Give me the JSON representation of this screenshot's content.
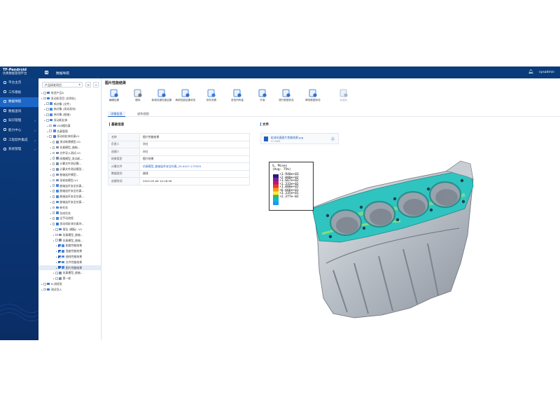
{
  "app": {
    "brand_title": "TF-Pandroid",
    "brand_subtitle": "仿真数据管理平台",
    "module_title": "数据导航",
    "user_name": "sysadmin"
  },
  "nav": {
    "items": [
      {
        "label": "平台主页",
        "active": false
      },
      {
        "label": "工作看板",
        "active": false
      },
      {
        "label": "数据导航",
        "active": true
      },
      {
        "label": "数据查询",
        "active": false
      },
      {
        "label": "知识管理",
        "active": false
      },
      {
        "label": "能力中心",
        "active": false
      },
      {
        "label": "工程软件集成",
        "active": false
      },
      {
        "label": "系统管理",
        "active": false
      }
    ]
  },
  "tree": {
    "select_value": "产品研发项目",
    "nodes": [
      {
        "label": "电池产品A",
        "indent": 1,
        "icon": "folder",
        "checked": false
      },
      {
        "label": "发动机项目 (实例化)",
        "indent": 1,
        "icon": "folder",
        "checked": false
      },
      {
        "label": "新对象 (文件)",
        "indent": 2,
        "icon": "file",
        "checked": false
      },
      {
        "label": "新对象 (发动机块)",
        "indent": 2,
        "icon": "file",
        "checked": false
      },
      {
        "label": "新对象 (曲轴)",
        "indent": 2,
        "icon": "file",
        "checked": false
      },
      {
        "label": "发动机缸体",
        "indent": 2,
        "icon": "folder",
        "checked": false
      },
      {
        "label": "V2B帽仿真",
        "indent": 3,
        "icon": "file",
        "checked": false
      },
      {
        "label": "仿真管理",
        "indent": 3,
        "icon": "file",
        "checked": false
      },
      {
        "label": "发动机缸体仿真V1",
        "indent": 3,
        "icon": "folder",
        "checked": false
      },
      {
        "label": "测试新建模型-V1",
        "indent": 4,
        "icon": "model",
        "checked": false
      },
      {
        "label": "仿真模型_曲轴…",
        "indent": 4,
        "icon": "model",
        "checked": false
      },
      {
        "label": "文件导入测试-V1",
        "indent": 4,
        "icon": "model",
        "checked": false
      },
      {
        "label": "网格模型_发动机…",
        "indent": 4,
        "icon": "model",
        "checked": false
      },
      {
        "label": "计算文件测试模…",
        "indent": 4,
        "icon": "model",
        "checked": false
      },
      {
        "label": "计算文件测试模型…",
        "indent": 4,
        "icon": "model",
        "checked": false
      },
      {
        "label": "曲轴连杆模型…",
        "indent": 4,
        "icon": "model",
        "checked": false
      },
      {
        "label": "张紧轮模型-V1",
        "indent": 4,
        "icon": "model",
        "checked": false
      },
      {
        "label": "曲轴连杆安全仿真…",
        "indent": 4,
        "icon": "file",
        "checked": false
      },
      {
        "label": "曲轴连杆安全仿真…",
        "indent": 4,
        "icon": "file",
        "checked": false
      },
      {
        "label": "曲轴连杆安全仿真…",
        "indent": 4,
        "icon": "file",
        "checked": false
      },
      {
        "label": "曲轴连杆安全仿真…",
        "indent": 4,
        "icon": "file",
        "checked": false
      },
      {
        "label": "新任务",
        "indent": 4,
        "icon": "file",
        "checked": false
      },
      {
        "label": "总成任务",
        "indent": 4,
        "icon": "file",
        "checked": false
      },
      {
        "label": "全手动流程",
        "indent": 4,
        "icon": "file",
        "checked": false
      },
      {
        "label": "发动机缸体仿真块…",
        "indent": 4,
        "icon": "folder",
        "checked": false
      },
      {
        "label": "报告 (模板) -V1",
        "indent": 5,
        "icon": "file",
        "checked": false
      },
      {
        "label": "仿真模型_曲轴…",
        "indent": 5,
        "icon": "model",
        "checked": false
      },
      {
        "label": "仿真模型_曲轴…",
        "indent": 5,
        "icon": "model",
        "checked": false
      },
      {
        "label": "刚度性能结果",
        "indent": 6,
        "icon": "file",
        "checked": true
      },
      {
        "label": "强度性能结果",
        "indent": 6,
        "icon": "file",
        "checked": true
      },
      {
        "label": "曲线性能结果",
        "indent": 6,
        "icon": "file",
        "checked": true
      },
      {
        "label": "文件性能结果",
        "indent": 6,
        "icon": "file",
        "checked": true
      },
      {
        "label": "图片性能结果",
        "indent": 6,
        "icon": "file",
        "checked": true,
        "selected": true
      },
      {
        "label": "仿真模型_曲轴…",
        "indent": 5,
        "icon": "model",
        "checked": false
      },
      {
        "label": "第一轮",
        "indent": 5,
        "icon": "model",
        "checked": false
      },
      {
        "label": "N-流程发",
        "indent": 1,
        "icon": "folder",
        "checked": false
      },
      {
        "label": "测试导入",
        "indent": 1,
        "icon": "folder",
        "checked": false
      }
    ]
  },
  "page": {
    "title": "图片性能结果",
    "tools": [
      {
        "label": "编辑结果",
        "icon": "edit-icon",
        "disabled": false
      },
      {
        "label": "删除",
        "icon": "delete-icon",
        "disabled": false
      },
      {
        "label": "新增关键性能结果",
        "icon": "add-kpi-icon",
        "disabled": false
      },
      {
        "label": "刷新性能结果状态",
        "icon": "refresh-status-icon",
        "disabled": false
      },
      {
        "label": "软件查看",
        "icon": "software-view-icon",
        "disabled": false
      },
      {
        "label": "查找所有者",
        "icon": "find-owner-icon",
        "disabled": false
      },
      {
        "label": "升版",
        "icon": "upgrade-icon",
        "disabled": false
      },
      {
        "label": "提升数据状态",
        "icon": "promote-state-icon",
        "disabled": false
      },
      {
        "label": "降低数据状态",
        "icon": "demote-state-icon",
        "disabled": false
      },
      {
        "label": "轻量化",
        "icon": "lightweight-icon",
        "disabled": true
      }
    ],
    "tabs": [
      {
        "label": "详情信息",
        "active": true
      },
      {
        "label": "谱系视图",
        "active": false
      }
    ]
  },
  "basic_info": {
    "section_title": "基础信息",
    "rows": [
      {
        "key": "名称",
        "value": "图片性能结果",
        "link": false
      },
      {
        "key": "负责人",
        "value": "孙红",
        "link": false
      },
      {
        "key": "创建人",
        "value": "孙红",
        "link": false
      },
      {
        "key": "结果类型",
        "value": "图片结果",
        "link": false
      },
      {
        "key": "计算文件",
        "value": "仿真模型_曲轴连杆安全仿真_25-0427-173555",
        "link": true
      },
      {
        "key": "数据类别",
        "value": "曲线",
        "link": false
      },
      {
        "key": "创建时间",
        "value": "2025-05-06 10:16:56",
        "link": false
      }
    ]
  },
  "files": {
    "section_title": "文件",
    "file_name": "缸体仿真图片性能结果.jpg",
    "file_size": "57.09KB"
  },
  "result_image": {
    "legend_title_1": "S, Mises",
    "legend_title_2": "(Avg: 75%)",
    "legend_values": [
      "+1.940e+03",
      "+2.000e+02",
      "+1.667e+02",
      "+1.333e+02",
      "+1.000e+02",
      "+6.666e+01",
      "+3.335e+01",
      "+2.377e-02"
    ],
    "legend_colors": [
      "#2a1a7a",
      "#7b1fa2",
      "#c2185b",
      "#e53935",
      "#ff9800",
      "#ffeb3b",
      "#4caf50",
      "#00bcd4",
      "#2196f3"
    ]
  }
}
